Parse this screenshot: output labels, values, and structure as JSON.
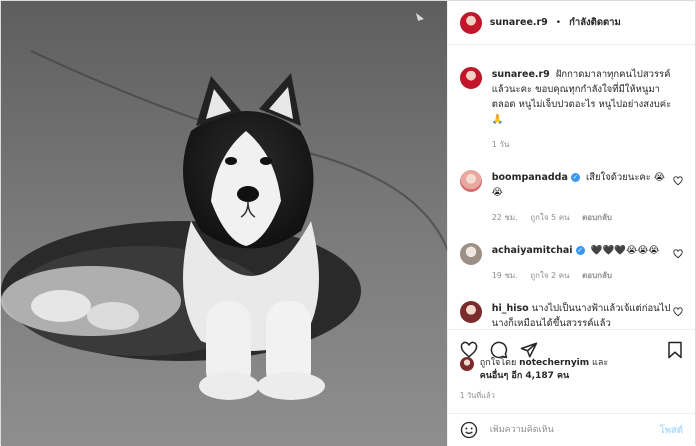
{
  "header": {
    "username": "sunaree.r9",
    "separator": "•",
    "follow_label": "กำลังติดตาม"
  },
  "caption": {
    "username": "sunaree.r9",
    "text": "ฝักกาดมาลาทุกคนไปสวรรค์แล้วนะคะ ขอบคุณทุกกำลังใจที่มีให้หนูมาตลอด หนูไม่เจ็บปวดอะไร หนูไปอย่างสงบค่ะ🙏",
    "time": "1 วัน"
  },
  "comments": [
    {
      "username": "boompanadda",
      "verified": true,
      "text": "เสียใจด้วยนะคะ 😭😭",
      "time": "22 ชม.",
      "likes": "ถูกใจ 5 คน",
      "reply": "ตอบกลับ"
    },
    {
      "username": "achaiyamitchai",
      "verified": true,
      "text": "🖤🖤🖤😭😭😭",
      "time": "19 ชม.",
      "likes": "ถูกใจ 2 คน",
      "reply": "ตอบกลับ"
    },
    {
      "username": "hi_hiso",
      "verified": false,
      "text": "นางไปเป็นนางฟ้าแล้วเจ้แต่ก่อนไปนางก็เหมือนได้ขึ้นสวรรค์แล้ว",
      "time": "",
      "likes": "",
      "reply": ""
    }
  ],
  "likes": {
    "prefix": "ถูกใจโดย",
    "user": "notechernyim",
    "and": "และ",
    "others": "คนอื่นๆ อีก 4,187 คน"
  },
  "time_ago": "1 วันที่แล้ว",
  "comment_input": {
    "placeholder": "เพิ่มความคิดเห็น",
    "post_label": "โพสต์"
  },
  "icons": {
    "heart": "heart-icon",
    "comment": "comment-icon",
    "share": "share-icon",
    "save": "bookmark-icon",
    "emoji": "emoji-icon"
  },
  "colors": {
    "accent": "#3897f0",
    "post_disabled": "#b2dffc",
    "muted": "#8e8e8e"
  }
}
